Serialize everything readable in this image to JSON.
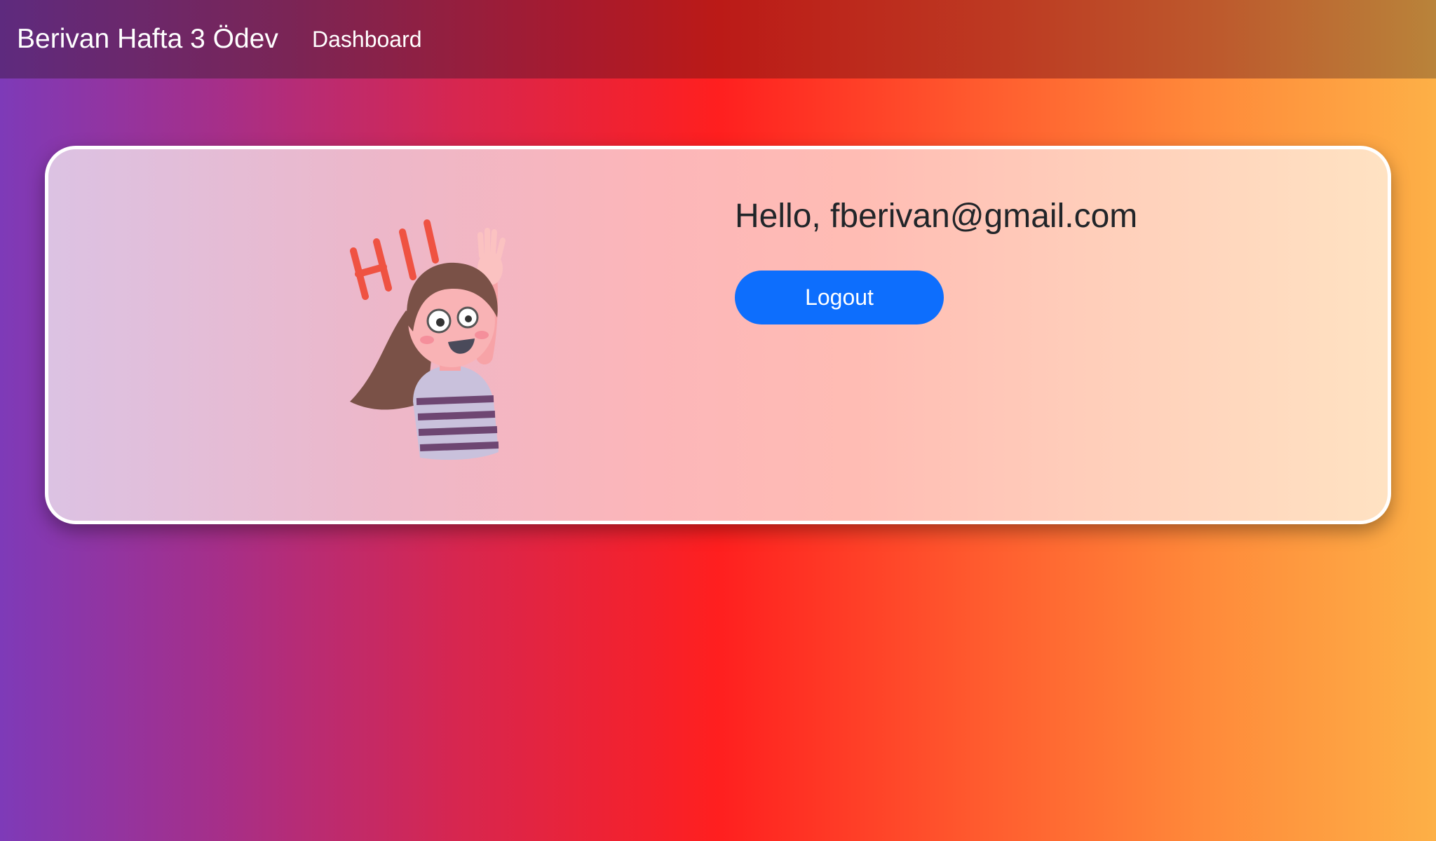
{
  "navbar": {
    "brand": "Berivan Hafta 3 Ödev",
    "links": [
      {
        "label": "Dashboard"
      }
    ]
  },
  "card": {
    "greeting": "Hello, fberivan@gmail.com",
    "logout_label": "Logout",
    "illustration": {
      "icon": "waving-girl-illustration",
      "lettering": "HI!"
    }
  },
  "colors": {
    "button": "#0d6efd",
    "greeting_text": "#212529",
    "card_border": "#ffffff"
  }
}
